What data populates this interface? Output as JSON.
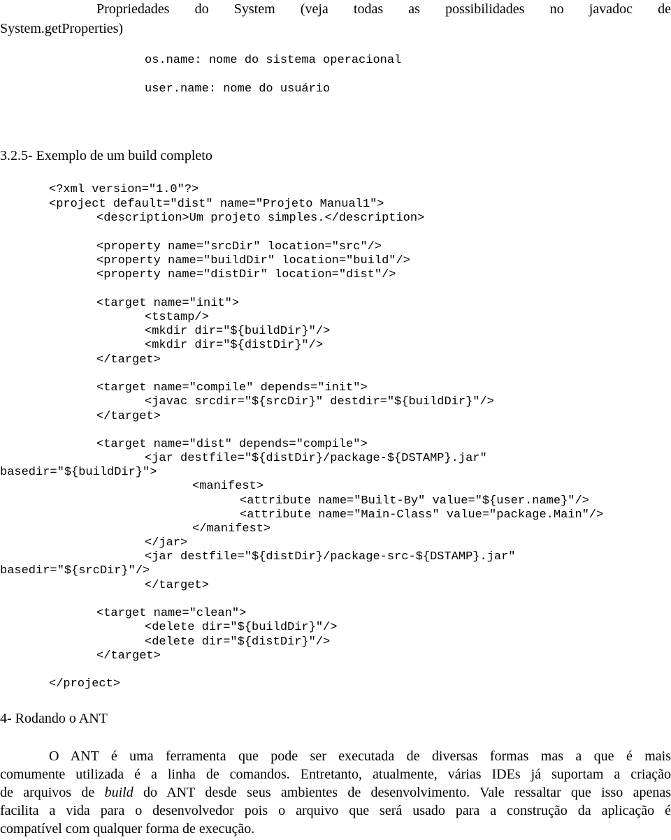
{
  "intro": {
    "line1": "Propriedades do System (veja todas as possibilidades no javadoc de",
    "line2": "System.getProperties)"
  },
  "properties": [
    "os.name: nome do sistema operacional",
    "user.name: nome do usuário"
  ],
  "section_325": "3.2.5- Exemplo de um build completo",
  "code": [
    "<?xml version=\"1.0\"?>",
    "<project default=\"dist\" name=\"Projeto Manual1\">",
    "<description>Um projeto simples.</description>",
    "<property name=\"srcDir\" location=\"src\"/>",
    "<property name=\"buildDir\" location=\"build\"/>",
    "<property name=\"distDir\" location=\"dist\"/>",
    "<target name=\"init\">",
    "<tstamp/>",
    "<mkdir dir=\"${buildDir}\"/>",
    "<mkdir dir=\"${distDir}\"/>",
    "</target>",
    "<target name=\"compile\" depends=\"init\">",
    "<javac srcdir=\"${srcDir}\" destdir=\"${buildDir}\"/>",
    "</target>",
    "<target name=\"dist\" depends=\"compile\">",
    "<jar destfile=\"${distDir}/package-${DSTAMP}.jar\"",
    "basedir=\"${buildDir}\">",
    "<manifest>",
    "<attribute name=\"Built-By\" value=\"${user.name}\"/>",
    "<attribute name=\"Main-Class\" value=\"package.Main\"/>",
    "</manifest>",
    "</jar>",
    "<jar destfile=\"${distDir}/package-src-${DSTAMP}.jar\"",
    "basedir=\"${srcDir}\"/>",
    "</target>",
    "<target name=\"clean\">",
    "<delete dir=\"${buildDir}\"/>",
    "<delete dir=\"${distDir}\"/>",
    "</target>",
    "</project>"
  ],
  "section_4": "4- Rodando o ANT",
  "body": {
    "line1": "O ANT é uma ferramenta que pode ser executada de diversas formas mas a que é mais",
    "line2": "comumente utilizada é a linha de comandos. Entretanto, atualmente, várias IDEs já suportam a criação",
    "line3_a": "de arquivos de ",
    "line3_em": "build",
    "line3_b": " do ANT desde seus ambientes de desenvolvimento. Vale ressaltar que isso apenas",
    "line4": "facilita a vida para o desenvolvedor pois o arquivo que será usado para a construção da aplicação é",
    "line5": "compatível com qualquer forma de execução."
  }
}
